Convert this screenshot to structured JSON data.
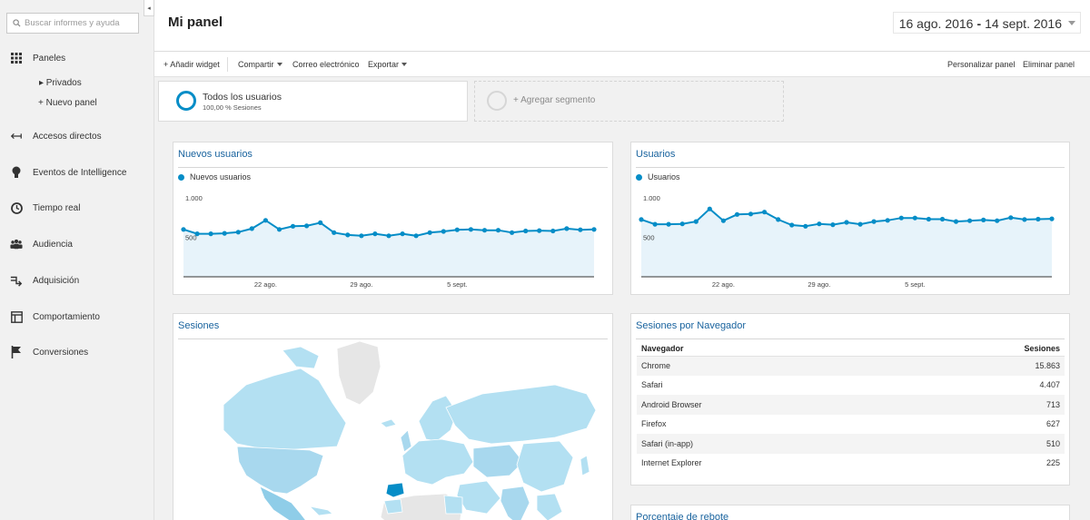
{
  "sidebar": {
    "search_placeholder": "Buscar informes y ayuda",
    "collapse_icon": "◂",
    "items": [
      {
        "label": "Paneles",
        "icon": "grid-icon"
      },
      {
        "label": "Accesos directos",
        "icon": "shortcut-arrows-icon"
      },
      {
        "label": "Eventos de Intelligence",
        "icon": "lightbulb-icon"
      },
      {
        "label": "Tiempo real",
        "icon": "clock-icon"
      },
      {
        "label": "Audiencia",
        "icon": "people-icon"
      },
      {
        "label": "Adquisición",
        "icon": "acquisition-arrows-icon"
      },
      {
        "label": "Comportamiento",
        "icon": "layout-icon"
      },
      {
        "label": "Conversiones",
        "icon": "flag-icon"
      }
    ],
    "sub_items": [
      "▸ Privados",
      "+ Nuevo panel"
    ]
  },
  "header": {
    "title": "Mi panel",
    "date_start": "16 ago. 2016",
    "date_sep": "-",
    "date_end": "14 sept. 2016"
  },
  "toolbar": {
    "add_widget": "+ Añadir widget",
    "share": "Compartir",
    "email": "Correo electrónico",
    "export": "Exportar",
    "customize": "Personalizar panel",
    "delete": "Eliminar panel"
  },
  "segments": {
    "all_users_title": "Todos los usuarios",
    "all_users_sub": "100,00 % Sesiones",
    "add_segment": "+ Agregar segmento"
  },
  "widgets": {
    "new_users": {
      "title": "Nuevos usuarios",
      "legend": "Nuevos usuarios"
    },
    "users": {
      "title": "Usuarios",
      "legend": "Usuarios"
    },
    "sessions_map": {
      "title": "Sesiones"
    },
    "browsers": {
      "title": "Sesiones por Navegador",
      "col_browser": "Navegador",
      "col_sessions": "Sesiones",
      "rows": [
        {
          "browser": "Chrome",
          "sessions": "15.863"
        },
        {
          "browser": "Safari",
          "sessions": "4.407"
        },
        {
          "browser": "Android Browser",
          "sessions": "713"
        },
        {
          "browser": "Firefox",
          "sessions": "627"
        },
        {
          "browser": "Safari (in-app)",
          "sessions": "510"
        },
        {
          "browser": "Internet Explorer",
          "sessions": "225"
        }
      ]
    },
    "bounce": {
      "title": "Porcentaje de rebote"
    }
  },
  "colors": {
    "series": "#058dc7",
    "area_fill": "#e7f3fa",
    "map_low": "#b3e0f2",
    "map_high": "#058dc7",
    "map_none": "#e6e6e6"
  },
  "chart_data": [
    {
      "type": "area",
      "series": [
        {
          "name": "Nuevos usuarios",
          "values": [
            600,
            545,
            545,
            550,
            565,
            610,
            715,
            600,
            640,
            645,
            685,
            560,
            530,
            520,
            545,
            520,
            545,
            520,
            560,
            575,
            595,
            600,
            590,
            590,
            560,
            580,
            585,
            580,
            610,
            595,
            600
          ]
        }
      ],
      "x_tick_labels": [
        "22 ago.",
        "29 ago.",
        "5 sept."
      ],
      "x_tick_indices": [
        6,
        13,
        20
      ],
      "y_tick_labels": [
        "1.000",
        "500"
      ],
      "y_ticks": [
        1000,
        500
      ],
      "ylim": [
        0,
        1000
      ]
    },
    {
      "type": "area",
      "series": [
        {
          "name": "Usuarios",
          "values": [
            725,
            665,
            665,
            670,
            700,
            860,
            710,
            790,
            795,
            820,
            725,
            655,
            640,
            670,
            660,
            690,
            665,
            700,
            715,
            745,
            745,
            730,
            730,
            700,
            710,
            720,
            710,
            750,
            725,
            730,
            735
          ]
        }
      ],
      "x_tick_labels": [
        "22 ago.",
        "29 ago.",
        "5 sept."
      ],
      "x_tick_indices": [
        6,
        13,
        20
      ],
      "y_tick_labels": [
        "1.000",
        "500"
      ],
      "y_ticks": [
        1000,
        500
      ],
      "ylim": [
        0,
        1000
      ]
    }
  ]
}
